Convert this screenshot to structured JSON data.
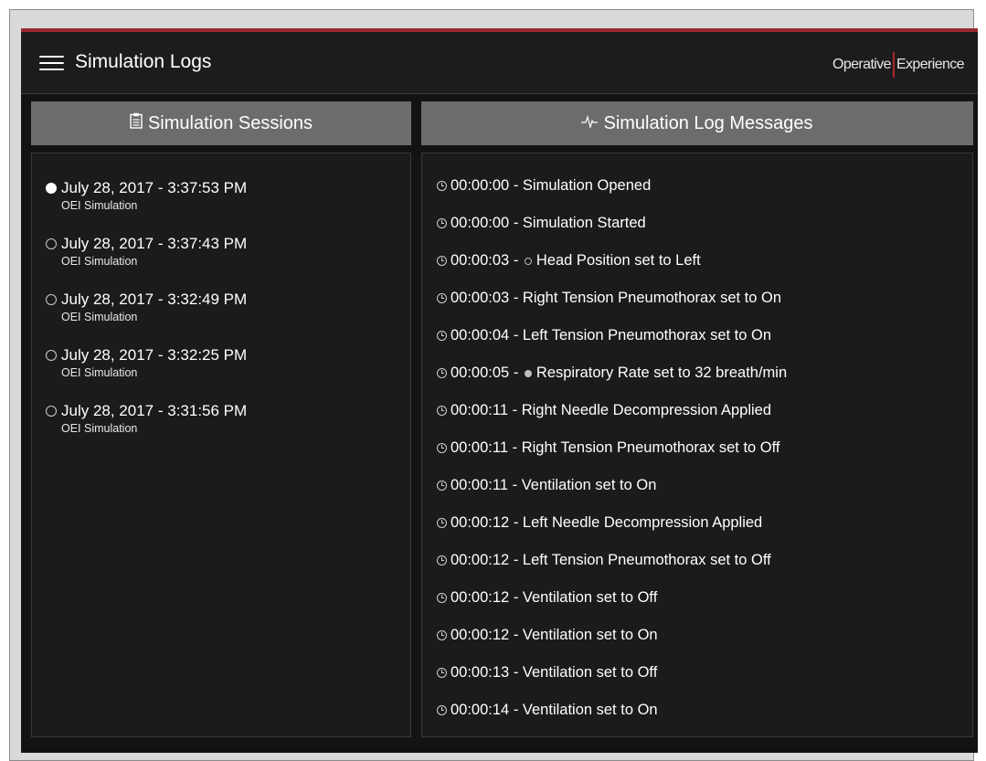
{
  "header": {
    "title": "Simulation Logs",
    "brand_left": "Operative",
    "brand_right": "Experience"
  },
  "sessions_panel": {
    "title": "Simulation Sessions",
    "items": [
      {
        "datetime": "July 28, 2017 - 3:37:53 PM",
        "subtitle": "OEI Simulation",
        "selected": true
      },
      {
        "datetime": "July 28, 2017 - 3:37:43 PM",
        "subtitle": "OEI Simulation",
        "selected": false
      },
      {
        "datetime": "July 28, 2017 - 3:32:49 PM",
        "subtitle": "OEI Simulation",
        "selected": false
      },
      {
        "datetime": "July 28, 2017 - 3:32:25 PM",
        "subtitle": "OEI Simulation",
        "selected": false
      },
      {
        "datetime": "July 28, 2017 - 3:31:56 PM",
        "subtitle": "OEI Simulation",
        "selected": false
      }
    ]
  },
  "log_panel": {
    "title": "Simulation Log Messages",
    "messages": [
      {
        "time": "00:00:00",
        "text": "Simulation Opened",
        "marker": ""
      },
      {
        "time": "00:00:00",
        "text": "Simulation Started",
        "marker": ""
      },
      {
        "time": "00:00:03",
        "text": "Head Position set to Left",
        "marker": "hollow-circle-icon"
      },
      {
        "time": "00:00:03",
        "text": "Right Tension Pneumothorax set to On",
        "marker": ""
      },
      {
        "time": "00:00:04",
        "text": "Left Tension Pneumothorax set to On",
        "marker": ""
      },
      {
        "time": "00:00:05",
        "text": "Respiratory Rate set to 32 breath/min",
        "marker": "filled-circle-icon"
      },
      {
        "time": "00:00:11",
        "text": "Right Needle Decompression Applied",
        "marker": ""
      },
      {
        "time": "00:00:11",
        "text": "Right Tension Pneumothorax set to Off",
        "marker": ""
      },
      {
        "time": "00:00:11",
        "text": "Ventilation set to On",
        "marker": ""
      },
      {
        "time": "00:00:12",
        "text": "Left Needle Decompression Applied",
        "marker": ""
      },
      {
        "time": "00:00:12",
        "text": "Left Tension Pneumothorax set to Off",
        "marker": ""
      },
      {
        "time": "00:00:12",
        "text": "Ventilation set to Off",
        "marker": ""
      },
      {
        "time": "00:00:12",
        "text": "Ventilation set to On",
        "marker": ""
      },
      {
        "time": "00:00:13",
        "text": "Ventilation set to Off",
        "marker": ""
      },
      {
        "time": "00:00:14",
        "text": "Ventilation set to On",
        "marker": ""
      }
    ]
  },
  "colors": {
    "accent": "#9b2a2f",
    "panel_header": "#6c6c6c",
    "background": "#131313"
  }
}
